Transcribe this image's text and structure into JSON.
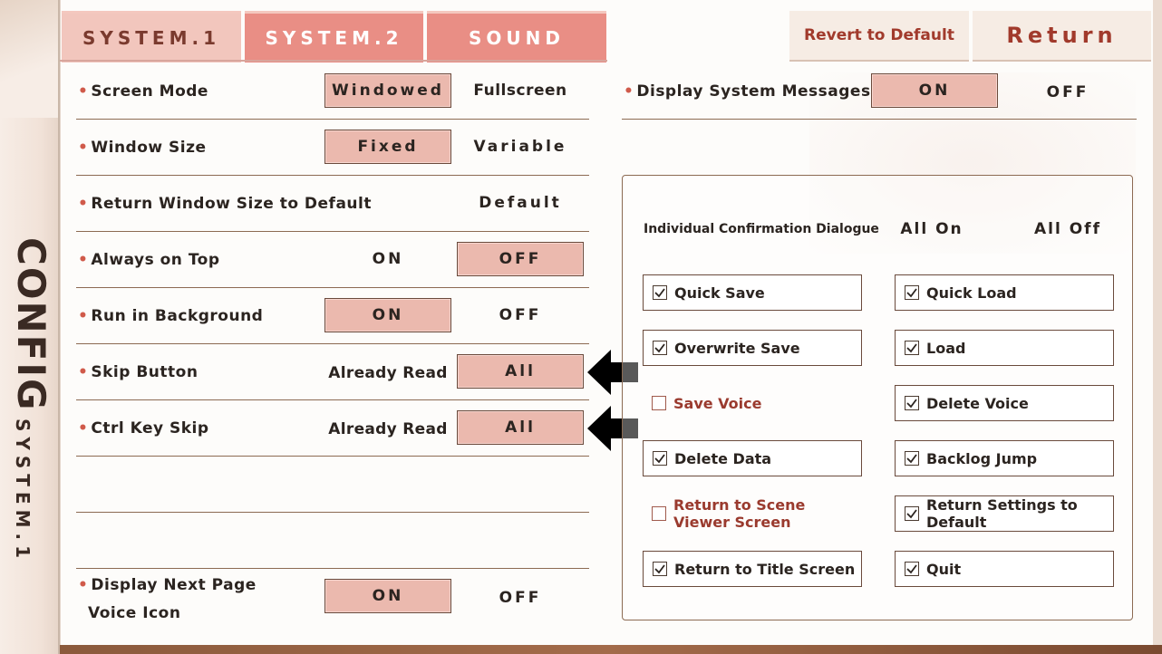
{
  "sidebar": {
    "title": "CONFIG",
    "subtitle": "SYSTEM.1"
  },
  "tabs": [
    {
      "label": "SYSTEM.1",
      "active": true
    },
    {
      "label": "SYSTEM.2",
      "active": false
    },
    {
      "label": "SOUND",
      "active": false
    }
  ],
  "top_buttons": {
    "revert": "Revert to Default",
    "return": "Return"
  },
  "settings": {
    "screen_mode": {
      "label": "Screen Mode",
      "opt1": "Windowed",
      "opt2": "Fullscreen"
    },
    "window_size": {
      "label": "Window Size",
      "opt1": "Fixed",
      "opt2": "Variable"
    },
    "return_size": {
      "label": "Return Window Size to Default",
      "opt1": "Default"
    },
    "always_on_top": {
      "label": "Always on Top",
      "opt1": "ON",
      "opt2": "OFF"
    },
    "run_bg": {
      "label": "Run in Background",
      "opt1": "ON",
      "opt2": "OFF"
    },
    "skip_button": {
      "label": "Skip Button",
      "opt1": "Already Read",
      "opt2": "All"
    },
    "ctrl_skip": {
      "label": "Ctrl Key Skip",
      "opt1": "Already Read",
      "opt2": "All"
    },
    "next_page_icon": {
      "label_line1": "Display Next Page",
      "label_line2": "Voice Icon",
      "opt1": "ON",
      "opt2": "OFF"
    },
    "sys_messages": {
      "label": "Display System Messages",
      "opt1": "ON",
      "opt2": "OFF"
    }
  },
  "confirm": {
    "heading": "Individual Confirmation Dialogue",
    "all_on": "All On",
    "all_off": "All Off",
    "items": [
      {
        "label": "Quick Save",
        "checked": true
      },
      {
        "label": "Quick Load",
        "checked": true
      },
      {
        "label": "Overwrite Save",
        "checked": true
      },
      {
        "label": "Load",
        "checked": true
      },
      {
        "label": "Save Voice",
        "checked": false
      },
      {
        "label": "Delete Voice",
        "checked": true
      },
      {
        "label": "Delete Data",
        "checked": true
      },
      {
        "label": "Backlog Jump",
        "checked": true
      },
      {
        "label": "Return to Scene Viewer Screen",
        "checked": false
      },
      {
        "label": "Return Settings to Default",
        "checked": true
      },
      {
        "label": "Return to Title Screen",
        "checked": true
      },
      {
        "label": "Quit",
        "checked": true
      }
    ]
  },
  "colors": {
    "accent": "#e98e85",
    "selected": "#ebb9ae",
    "text": "#2b2420",
    "link_red": "#a13a2c"
  },
  "icons": {
    "arrow": "left-arrow-icon",
    "checkbox": "checkmark-icon"
  }
}
